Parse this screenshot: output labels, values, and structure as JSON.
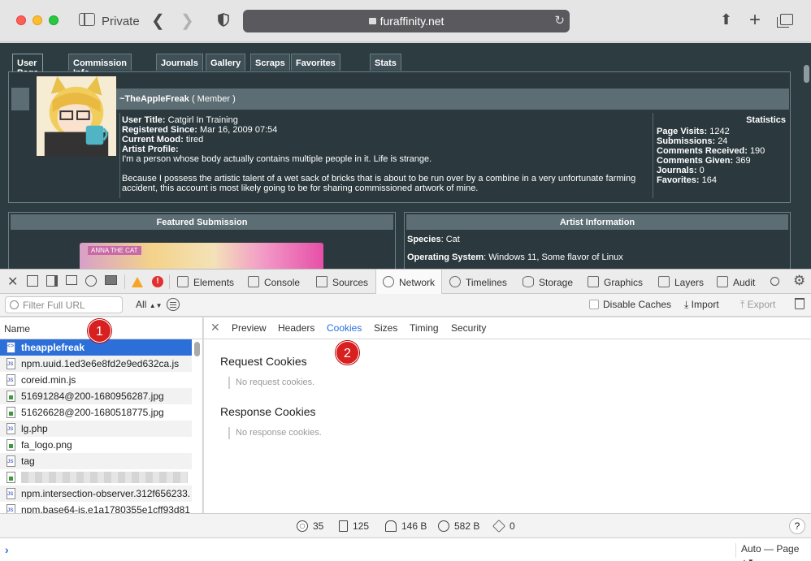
{
  "browser": {
    "private_label": "Private",
    "url": "furaffinity.net"
  },
  "site": {
    "tabs": [
      "User Page",
      "Commission Info",
      "Journals",
      "Gallery",
      "Scraps",
      "Favorites",
      "Stats"
    ],
    "username": "~TheAppleFreak",
    "member_type": "( Member )",
    "info": {
      "user_title_label": "User Title:",
      "user_title": "Catgirl In Training",
      "registered_label": "Registered Since:",
      "registered": "Mar 16, 2009 07:54",
      "mood_label": "Current Mood:",
      "mood": "tired",
      "artist_profile_label": "Artist Profile:",
      "bio_line1": "I'm a person whose body actually contains multiple people in it. Life is strange.",
      "bio_line2": "Because I possess the artistic talent of a wet sack of bricks that is about to be run over by a combine in a very unfortunate farming accident, this account is most likely going to be for sharing commissioned artwork of mine."
    },
    "statistics": {
      "title": "Statistics",
      "items": [
        {
          "label": "Page Visits:",
          "value": "1242"
        },
        {
          "label": "Submissions:",
          "value": "24"
        },
        {
          "label": "Comments Received:",
          "value": "190"
        },
        {
          "label": "Comments Given:",
          "value": "369"
        },
        {
          "label": "Journals:",
          "value": "0"
        },
        {
          "label": "Favorites:",
          "value": "164"
        }
      ]
    },
    "featured_title": "Featured Submission",
    "featured_tag": "ANNA THE CAT",
    "artist_info_title": "Artist Information",
    "species_label": "Species",
    "species": "Cat",
    "os_label": "Operating System",
    "os": "Windows 11, Some flavor of Linux"
  },
  "inspector": {
    "tabs": [
      "Elements",
      "Console",
      "Sources",
      "Network",
      "Timelines",
      "Storage",
      "Graphics",
      "Layers",
      "Audit"
    ],
    "error_count": "!",
    "filter_placeholder": "Filter Full URL",
    "type_filter": "All",
    "disable_caches": "Disable Caches",
    "import": "Import",
    "export": "Export",
    "name_header": "Name",
    "requests": [
      {
        "name": "theapplefreak",
        "kind": "doc"
      },
      {
        "name": "npm.uuid.1ed3e6e8fd2e9ed632ca.js",
        "kind": "js"
      },
      {
        "name": "coreid.min.js",
        "kind": "js"
      },
      {
        "name": "51691284@200-1680956287.jpg",
        "kind": "img"
      },
      {
        "name": "51626628@200-1680518775.jpg",
        "kind": "img"
      },
      {
        "name": "lg.php",
        "kind": "js"
      },
      {
        "name": "fa_logo.png",
        "kind": "img"
      },
      {
        "name": "tag",
        "kind": "js"
      },
      {
        "name": "",
        "kind": "img"
      },
      {
        "name": "npm.intersection-observer.312f656233.",
        "kind": "js"
      },
      {
        "name": "npm.base64-js.e1a1780355e1cff93d81",
        "kind": "js"
      }
    ],
    "detail_tabs": [
      "Preview",
      "Headers",
      "Cookies",
      "Sizes",
      "Timing",
      "Security"
    ],
    "request_cookies_title": "Request Cookies",
    "request_cookies_empty": "No request cookies.",
    "response_cookies_title": "Response Cookies",
    "response_cookies_empty": "No response cookies.",
    "status": {
      "requests": "35",
      "resources": "125",
      "transferred": "146 B",
      "size": "582 B",
      "redirects": "0"
    },
    "help": "?",
    "context": "Auto — Page"
  },
  "annotations": [
    "1",
    "2"
  ]
}
